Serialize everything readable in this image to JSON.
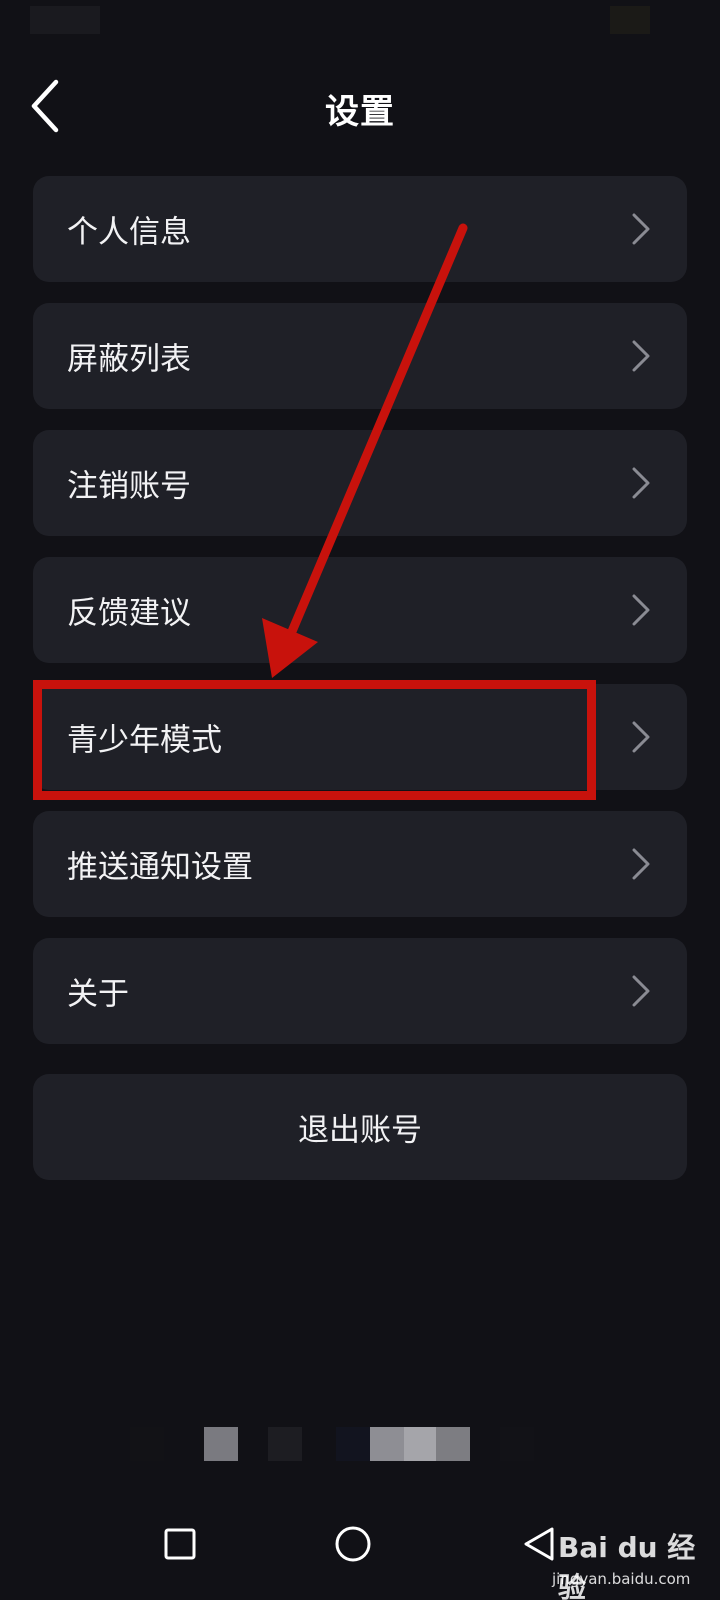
{
  "header": {
    "title": "设置",
    "back_icon": "chevron-left-icon"
  },
  "menu": {
    "items": [
      {
        "label": "个人信息",
        "icon": "chevron-right-icon"
      },
      {
        "label": "屏蔽列表",
        "icon": "chevron-right-icon"
      },
      {
        "label": "注销账号",
        "icon": "chevron-right-icon"
      },
      {
        "label": "反馈建议",
        "icon": "chevron-right-icon"
      },
      {
        "label": "青少年模式",
        "icon": "chevron-right-icon",
        "highlighted": true
      },
      {
        "label": "推送通知设置",
        "icon": "chevron-right-icon"
      },
      {
        "label": "关于",
        "icon": "chevron-right-icon"
      }
    ]
  },
  "logout": {
    "label": "退出账号"
  },
  "annotation": {
    "color": "#c8120c",
    "target": "青少年模式"
  },
  "nav_bar": {
    "recents_icon": "square-icon",
    "home_icon": "circle-icon",
    "back_icon": "triangle-back-icon"
  },
  "watermark": {
    "brand": "Bai du 经验",
    "url": "jingyan.baidu.com"
  },
  "colors": {
    "background": "#111116",
    "card": "#1f2027",
    "text": "#f2f2f4",
    "chevron": "#8a8b93",
    "highlight": "#c8120c"
  }
}
